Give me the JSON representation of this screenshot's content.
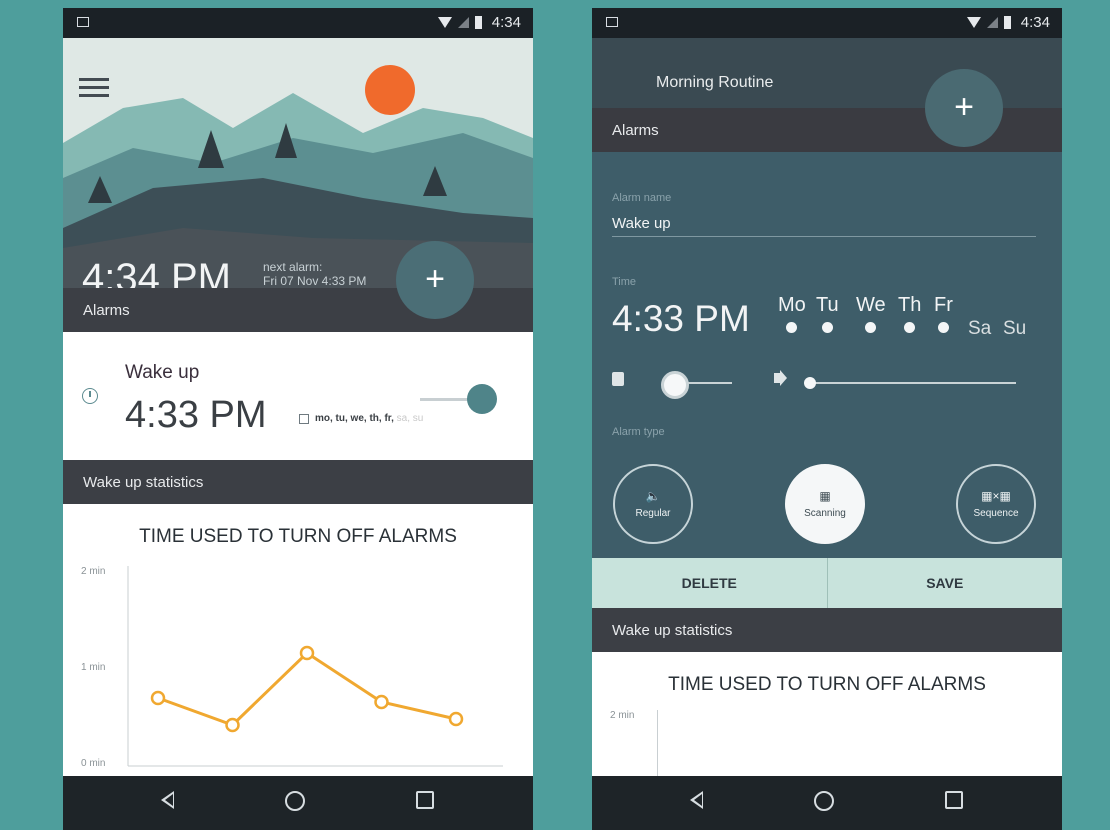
{
  "status_bar": {
    "time": "4:34"
  },
  "left": {
    "hero": {
      "time": "4:34 PM",
      "next_alarm_label": "next alarm:",
      "next_alarm_value": "Fri 07 Nov 4:33 PM"
    },
    "fab_label": "+",
    "alarms_header": "Alarms",
    "alarm": {
      "title": "Wake up",
      "time": "4:33 PM",
      "days_active": "mo, tu, we, th, fr,",
      "days_inactive": " sa, su",
      "enabled": true
    },
    "stats_header": "Wake up statistics",
    "chart_data": {
      "type": "line",
      "title": "TIME USED TO TURN OFF ALARMS",
      "y_ticks": [
        "2 min",
        "1 min",
        "0 min"
      ],
      "ylim": [
        0,
        2
      ],
      "x": [
        1,
        2,
        3,
        4,
        5
      ],
      "values": [
        0.68,
        0.41,
        1.13,
        0.64,
        0.47
      ],
      "color": "#f0a830"
    }
  },
  "right": {
    "toolbar_title": "Morning Routine",
    "fab_label": "+",
    "alarms_header": "Alarms",
    "alarm_name_label": "Alarm name",
    "alarm_name_value": "Wake up",
    "time_label": "Time",
    "time_value": "4:33 PM",
    "days": [
      {
        "label": "Mo",
        "active": true
      },
      {
        "label": "Tu",
        "active": true
      },
      {
        "label": "We",
        "active": true
      },
      {
        "label": "Th",
        "active": true
      },
      {
        "label": "Fr",
        "active": true
      },
      {
        "label": "Sa",
        "active": false
      },
      {
        "label": "Su",
        "active": false
      }
    ],
    "vibration_level": 0.1,
    "volume_level": 0.0,
    "alarm_type_label": "Alarm type",
    "alarm_types": [
      {
        "label": "Regular",
        "icon": "speaker-icon",
        "selected": false
      },
      {
        "label": "Scanning",
        "icon": "qr-code-icon",
        "selected": true
      },
      {
        "label": "Sequence",
        "icon": "qr-sequence-icon",
        "selected": false
      }
    ],
    "delete_label": "DELETE",
    "save_label": "SAVE",
    "stats_header": "Wake up statistics",
    "chart_title": "TIME USED TO TURN OFF ALARMS",
    "chart_top_tick": "2 min"
  }
}
